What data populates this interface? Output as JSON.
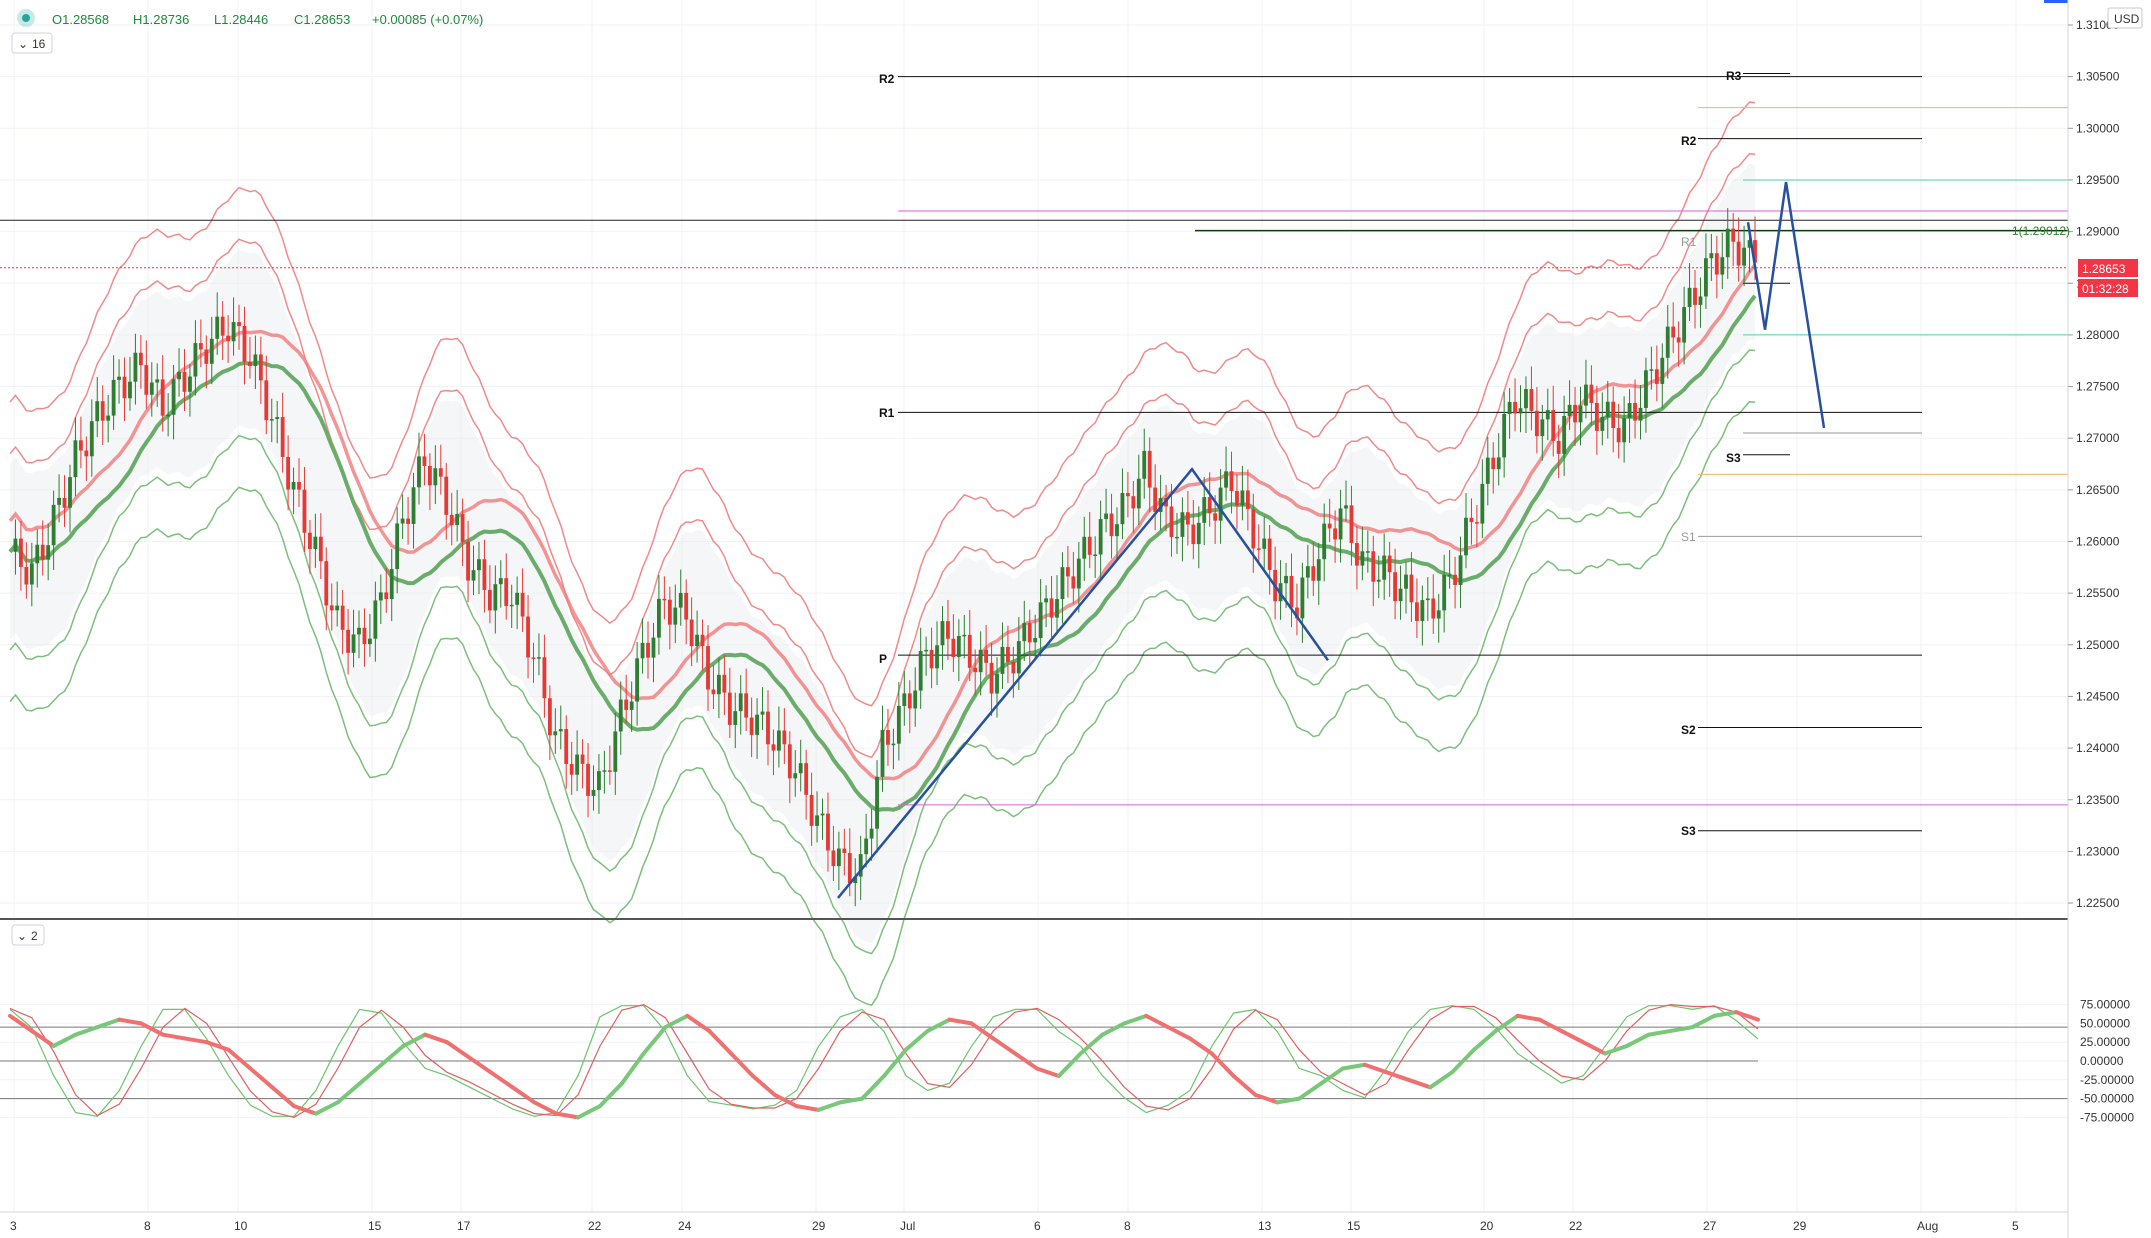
{
  "header": {
    "ohlc_open": "O1.28568",
    "ohlc_high": "H1.28736",
    "ohlc_low": "L1.28446",
    "ohlc_close": "C1.28653",
    "ohlc_change": "+0.00085 (+0.07%)",
    "indicator_badge": "16"
  },
  "lower_pane": {
    "indicator_badge": "2"
  },
  "price_axis": {
    "currency": "USD",
    "ticks": [
      "1.31000",
      "1.30500",
      "1.30000",
      "1.29500",
      "1.29000",
      "1.28500",
      "1.28000",
      "1.27500",
      "1.27000",
      "1.26500",
      "1.26000",
      "1.25500",
      "1.25000",
      "1.24500",
      "1.24000",
      "1.23500",
      "1.23000",
      "1.22500"
    ],
    "last_price": "1.28653",
    "countdown": "01:32:28"
  },
  "osc_axis": {
    "ticks": [
      "75.00000",
      "50.00000",
      "25.00000",
      "0.00000",
      "-25.00000",
      "-50.00000",
      "-75.00000"
    ]
  },
  "time_axis": {
    "labels": [
      "3",
      "8",
      "10",
      "15",
      "17",
      "22",
      "24",
      "29",
      "Jul",
      "6",
      "8",
      "13",
      "15",
      "20",
      "22",
      "27",
      "29",
      "Aug",
      "5"
    ]
  },
  "pivot_labels": {
    "left": [
      "R2",
      "R1",
      "P"
    ],
    "right": [
      "R3",
      "R2",
      "R1",
      "S3",
      "S1",
      "S2",
      "S3"
    ],
    "fib_label": "1(1.29012)"
  },
  "colors": {
    "bull": "#26a69a",
    "bear": "#ef5350",
    "candle_up": "#2e7d32",
    "candle_down": "#e53935",
    "ma_red": "#f08a8a",
    "ma_green": "#7cbf7c",
    "pattern_blue": "#2650a0",
    "price_tag": "#f23645"
  },
  "chart_data": [
    {
      "type": "candlestick",
      "title": "",
      "y_range": [
        1.2235,
        1.3105
      ],
      "x_range": [
        "3",
        "5 Aug"
      ],
      "series": [
        {
          "name": "price",
          "values": [
            1.259,
            1.257,
            1.262,
            1.268,
            1.272,
            1.275,
            1.277,
            1.273,
            1.276,
            1.279,
            1.281,
            1.278,
            1.272,
            1.265,
            1.259,
            1.252,
            1.25,
            1.254,
            1.262,
            1.268,
            1.264,
            1.258,
            1.255,
            1.255,
            1.249,
            1.241,
            1.238,
            1.236,
            1.243,
            1.249,
            1.254,
            1.253,
            1.247,
            1.244,
            1.243,
            1.241,
            1.238,
            1.233,
            1.229,
            1.228,
            1.24,
            1.244,
            1.249,
            1.251,
            1.249,
            1.247,
            1.249,
            1.252,
            1.255,
            1.258,
            1.261,
            1.263,
            1.267,
            1.262,
            1.261,
            1.263,
            1.266,
            1.261,
            1.256,
            1.254,
            1.259,
            1.263,
            1.258,
            1.257,
            1.255,
            1.253,
            1.256,
            1.262,
            1.268,
            1.274,
            1.272,
            1.27,
            1.274,
            1.272,
            1.271,
            1.275,
            1.279,
            1.283,
            1.287,
            1.289,
            1.287
          ]
        }
      ],
      "horizontal_levels": [
        1.305,
        1.302,
        1.299,
        1.295,
        1.292,
        1.2911,
        1.2901,
        1.2865,
        1.28,
        1.2725,
        1.2705,
        1.2665,
        1.2605,
        1.249,
        1.242,
        1.2345,
        1.232
      ]
    },
    {
      "type": "line",
      "title": "",
      "y_range": [
        -85,
        85
      ],
      "reference_lines": [
        45,
        0,
        -50
      ],
      "series": [
        {
          "name": "fast",
          "values": [
            60,
            40,
            20,
            35,
            45,
            55,
            50,
            35,
            30,
            25,
            15,
            -10,
            -35,
            -60,
            -70,
            -55,
            -30,
            -5,
            20,
            35,
            25,
            5,
            -15,
            -35,
            -55,
            -70,
            -75,
            -60,
            -30,
            10,
            45,
            60,
            40,
            10,
            -20,
            -45,
            -60,
            -65,
            -55,
            -50,
            -20,
            15,
            40,
            55,
            50,
            30,
            10,
            -10,
            -20,
            10,
            35,
            50,
            60,
            45,
            30,
            10,
            -20,
            -45,
            -55,
            -50,
            -30,
            -10,
            -5,
            -15,
            -25,
            -35,
            -15,
            15,
            40,
            60,
            55,
            40,
            25,
            10,
            20,
            35,
            40,
            45,
            60,
            65,
            55
          ]
        },
        {
          "name": "slow",
          "values": [
            70,
            45,
            -20,
            -70,
            -75,
            -40,
            20,
            70,
            70,
            30,
            -20,
            -60,
            -75,
            -75,
            -40,
            20,
            70,
            65,
            25,
            -10,
            -20,
            -35,
            -50,
            -65,
            -75,
            -70,
            -20,
            60,
            75,
            75,
            40,
            -20,
            -55,
            -60,
            -65,
            -60,
            -40,
            20,
            60,
            70,
            40,
            -20,
            -40,
            -30,
            20,
            60,
            70,
            70,
            40,
            20,
            -20,
            -50,
            -70,
            -60,
            -40,
            20,
            65,
            70,
            40,
            -10,
            -20,
            -40,
            -50,
            -10,
            40,
            70,
            75,
            70,
            45,
            10,
            -10,
            -30,
            -20,
            20,
            60,
            75,
            75,
            70,
            75,
            55,
            30
          ]
        }
      ]
    }
  ]
}
